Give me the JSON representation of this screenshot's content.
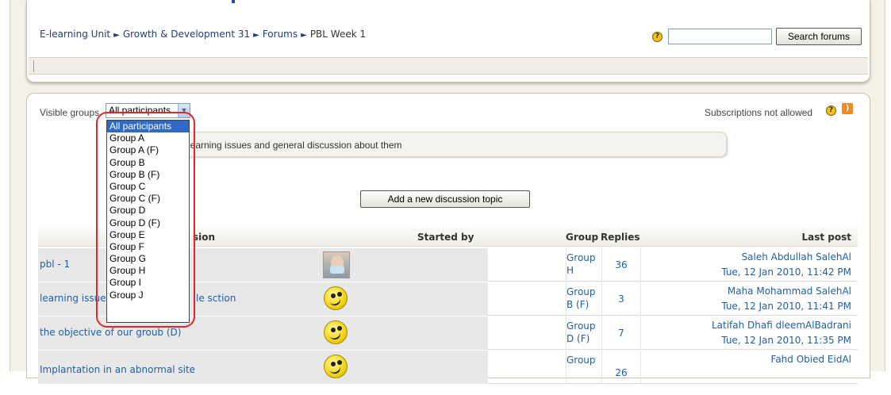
{
  "breadcrumb": {
    "items": [
      "E-learning Unit",
      "Growth & Development 31",
      "Forums"
    ],
    "current": "PBL Week 1",
    "separator": "►"
  },
  "search": {
    "button_label": "Search forums",
    "value": ""
  },
  "groups": {
    "label": "Visible groups",
    "selected": "All participants",
    "options": [
      "All participants",
      "Group A",
      "Group A (F)",
      "Group B",
      "Group B (F)",
      "Group C",
      "Group C (F)",
      "Group D",
      "Group D (F)",
      "Group E",
      "Group F",
      "Group G",
      "Group H",
      "Group I",
      "Group J"
    ]
  },
  "subscriptions": {
    "text": "Subscriptions not allowed"
  },
  "intro": {
    "text": "learning issues and general discussion about them"
  },
  "add_button": {
    "label": "Add a new discussion topic"
  },
  "table": {
    "headers": {
      "discussion": "sion",
      "started_by": "Started by",
      "group": "Group",
      "replies": "Replies",
      "last_post": "Last post"
    },
    "rows": [
      {
        "topic": "pbl - 1",
        "group_line1": "Group",
        "group_line2": "H",
        "replies": "36",
        "last_author": "Saleh Abdullah SalehAl",
        "last_date": "Tue, 12 Jan 2010, 11:42 PM",
        "avatar": "photo"
      },
      {
        "topic": "learning issues le sction",
        "topic_left": "learning issue",
        "topic_right": "le sction",
        "group_line1": "Group",
        "group_line2": "B (F)",
        "replies": "3",
        "last_author": "Maha Mohammad SalehAl",
        "last_date": "Tue, 12 Jan 2010, 11:41 PM",
        "avatar": "smiley"
      },
      {
        "topic": "the objective of our groub (D)",
        "group_line1": "Group",
        "group_line2": "D (F)",
        "replies": "7",
        "last_author": "Latifah Dhafi dleemAlBadrani",
        "last_date": "Tue, 12 Jan 2010, 11:35 PM",
        "avatar": "smiley"
      },
      {
        "topic": "Implantation in an abnormal site",
        "group_line1": "Group",
        "group_line2": "",
        "replies": "26",
        "last_author": "Fahd Obied EidAl",
        "last_date": "",
        "avatar": "smiley"
      }
    ]
  },
  "colors": {
    "link": "#1f5fa6",
    "highlight": "#e2262a",
    "selection": "#316ac5"
  }
}
